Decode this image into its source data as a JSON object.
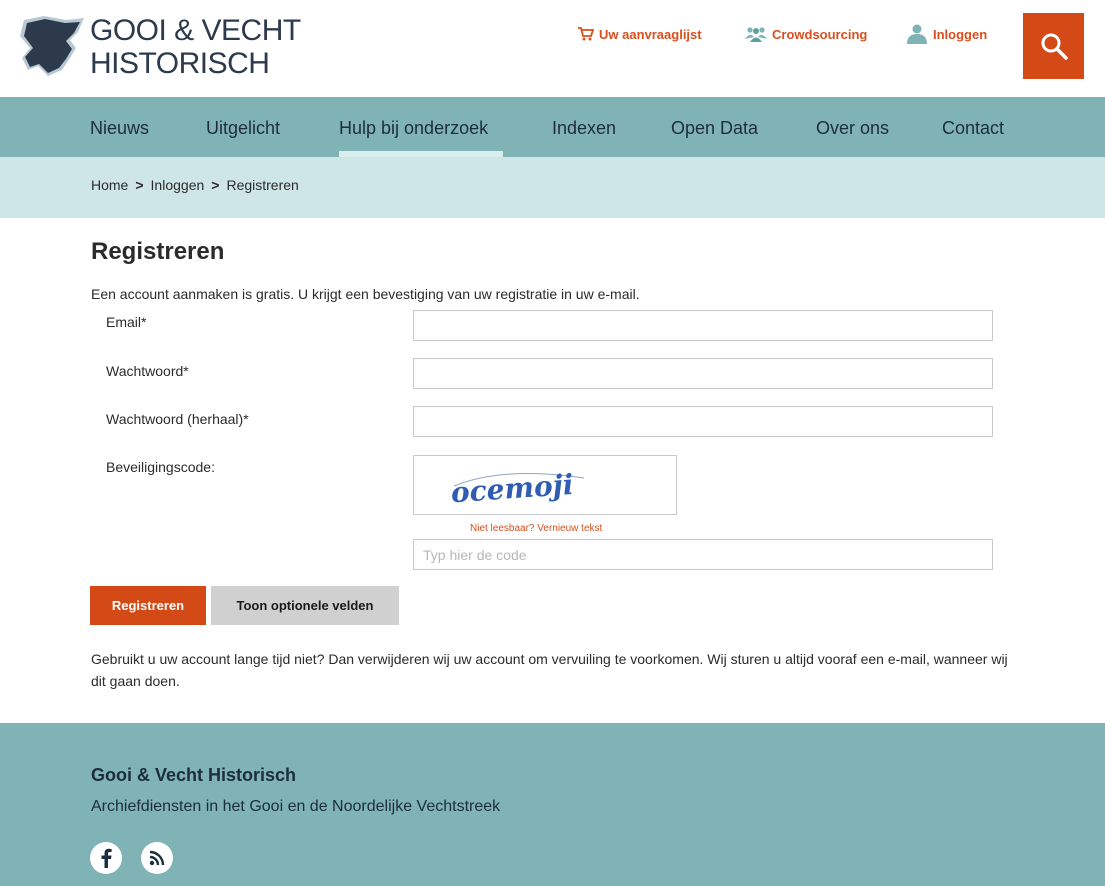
{
  "brand": {
    "line1": "GOOI & VECHT",
    "line2": "HISTORISCH"
  },
  "top_links": {
    "request_list": "Uw aanvraaglijst",
    "crowdsourcing": "Crowdsourcing",
    "login": "Inloggen"
  },
  "icons": {
    "logo": "region-map-logo",
    "request_list": "cart-icon",
    "crowdsourcing": "group-icon",
    "login": "user-icon",
    "search": "search-icon",
    "facebook": "facebook-icon",
    "rss": "rss-icon"
  },
  "nav": [
    {
      "label": "Nieuws"
    },
    {
      "label": "Uitgelicht"
    },
    {
      "label": "Hulp bij onderzoek",
      "active": true
    },
    {
      "label": "Indexen"
    },
    {
      "label": "Open Data"
    },
    {
      "label": "Over ons"
    },
    {
      "label": "Contact"
    }
  ],
  "breadcrumb": {
    "items": [
      "Home",
      "Inloggen",
      "Registreren"
    ],
    "separator": ">"
  },
  "page": {
    "title": "Registreren",
    "intro": "Een account aanmaken is gratis. U krijgt een bevestiging van uw registratie in uw e-mail."
  },
  "form": {
    "email_label": "Email*",
    "email_value": "",
    "password_label": "Wachtwoord*",
    "password_value": "",
    "password_repeat_label": "Wachtwoord (herhaal)*",
    "password_repeat_value": "",
    "captcha_label": "Beveiligingscode:",
    "captcha_text": "ocemoji",
    "captcha_refresh": "Niet leesbaar? Vernieuw tekst",
    "code_placeholder": "Typ hier de code",
    "code_value": "",
    "submit_label": "Registreren",
    "optional_label": "Toon optionele velden"
  },
  "notice": "Gebruikt u uw account lange tijd niet? Dan verwijderen wij uw account om vervuiling te voorkomen. Wij sturen u altijd vooraf een e-mail, wanneer wij dit gaan doen.",
  "footer": {
    "title": "Gooi & Vecht Historisch",
    "subtitle": "Archiefdiensten in het Gooi en de Noordelijke Vechtstreek"
  },
  "colors": {
    "accent": "#d34a16",
    "nav_bg": "#7fb3b5",
    "breadcrumb_bg": "#cfe6e6",
    "text_dark": "#2c3a4c"
  }
}
